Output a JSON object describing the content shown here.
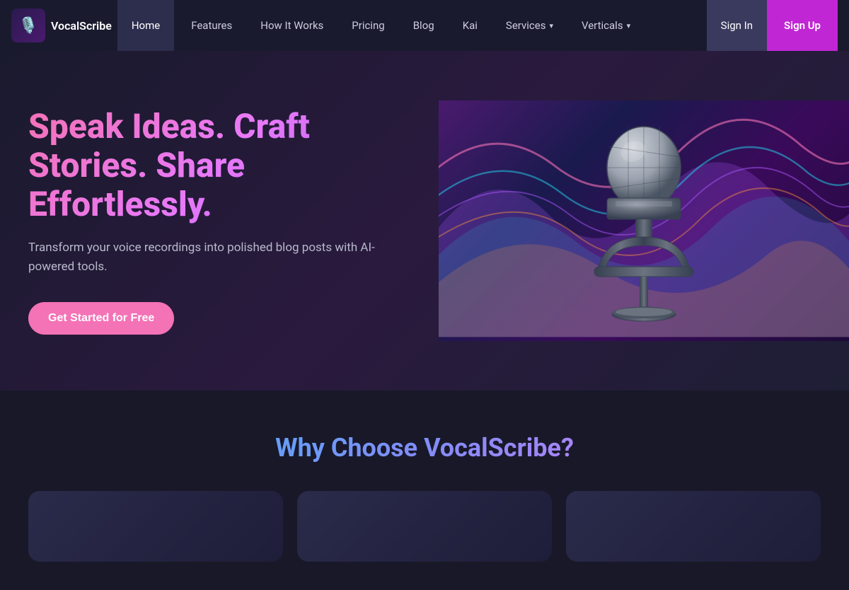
{
  "logo": {
    "icon_emoji": "🎙️",
    "text": "VocalScribe"
  },
  "nav": {
    "home_label": "Home",
    "links": [
      {
        "id": "features",
        "label": "Features"
      },
      {
        "id": "how-it-works",
        "label": "How It Works"
      },
      {
        "id": "pricing",
        "label": "Pricing"
      },
      {
        "id": "blog",
        "label": "Blog"
      },
      {
        "id": "kai",
        "label": "Kai"
      },
      {
        "id": "services",
        "label": "Services",
        "has_dropdown": true
      },
      {
        "id": "verticals",
        "label": "Verticals",
        "has_dropdown": true
      }
    ],
    "sign_in_label": "Sign In",
    "sign_up_label": "Sign Up"
  },
  "hero": {
    "title": "Speak Ideas. Craft Stories. Share Effortlessly.",
    "subtitle": "Transform your voice recordings into polished blog posts with AI-powered tools.",
    "cta_label": "Get Started for Free"
  },
  "why_section": {
    "title": "Why Choose VocalScribe?",
    "cards": [
      {
        "id": "card-1"
      },
      {
        "id": "card-2"
      },
      {
        "id": "card-3"
      }
    ]
  }
}
